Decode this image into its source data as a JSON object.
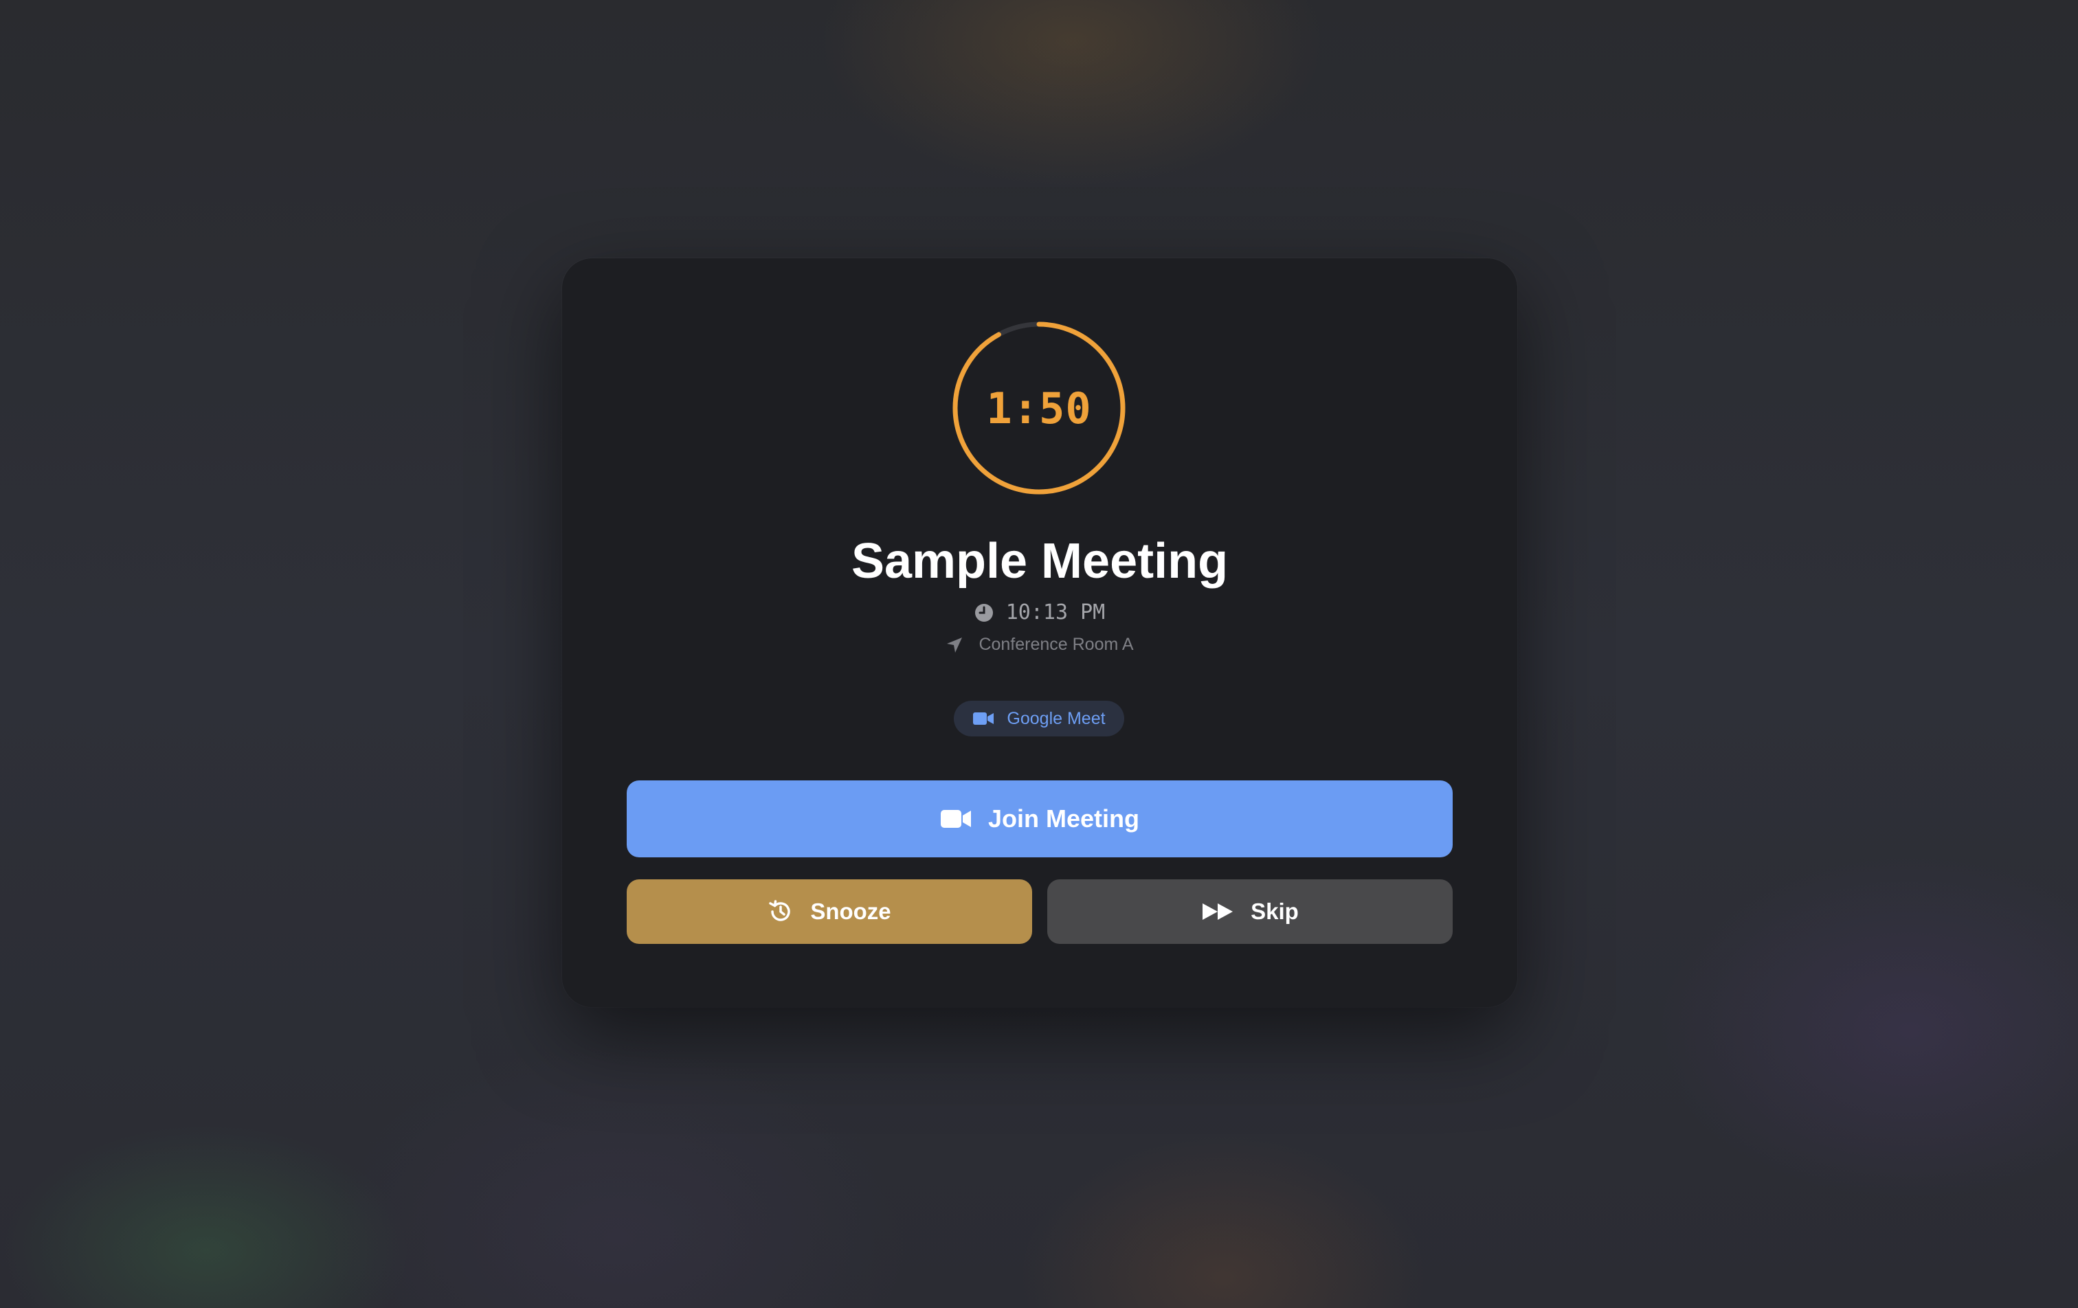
{
  "countdown": {
    "display": "1:50",
    "remaining_fraction": 0.92,
    "color": "#f0a23a"
  },
  "meeting": {
    "title": "Sample Meeting",
    "time": "10:13 PM",
    "location": "Conference Room A",
    "platform": "Google Meet"
  },
  "icons": {
    "time": "clock-icon",
    "location": "location-arrow-icon",
    "platform": "video-camera-icon"
  },
  "actions": {
    "join_label": "Join Meeting",
    "snooze_label": "Snooze",
    "skip_label": "Skip"
  },
  "colors": {
    "join": "#6b9cf3",
    "snooze": "#b58f4c",
    "skip": "#49494b"
  }
}
